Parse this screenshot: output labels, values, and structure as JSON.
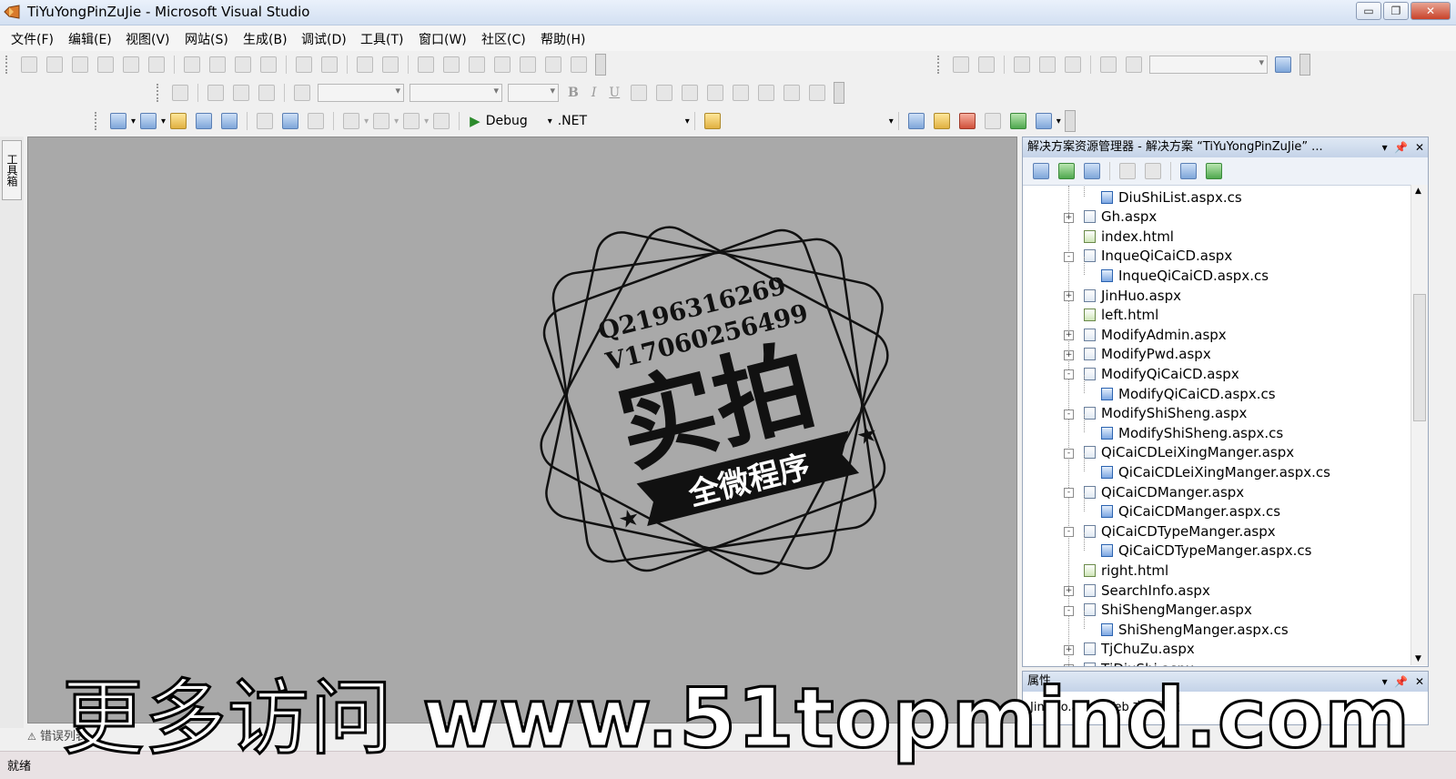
{
  "window": {
    "title": "TiYuYongPinZuJie - Microsoft Visual Studio",
    "minimize": "▭",
    "restore": "❐",
    "close": "✕"
  },
  "menu": [
    "文件(F)",
    "编辑(E)",
    "视图(V)",
    "网站(S)",
    "生成(B)",
    "调试(D)",
    "工具(T)",
    "窗口(W)",
    "社区(C)",
    "帮助(H)"
  ],
  "toolbar": {
    "config": "Debug",
    "platform": ".NET",
    "bold": "B",
    "italic": "I",
    "underline": "U"
  },
  "toolbox": {
    "label": "工具箱"
  },
  "editor": {
    "stamp": {
      "line1": "Q2196316269",
      "line2": "V17060256499",
      "big": "实拍",
      "banner": "全微程序"
    }
  },
  "solution_explorer": {
    "title": "解决方案资源管理器 - 解决方案 “TiYuYongPinZuJie” ...",
    "items": [
      {
        "label": "DiuShiList.aspx.cs",
        "type": "cs",
        "level": 2
      },
      {
        "label": "Gh.aspx",
        "type": "aspx",
        "level": 1,
        "expander": "+"
      },
      {
        "label": "index.html",
        "type": "html",
        "level": 1
      },
      {
        "label": "InqueQiCaiCD.aspx",
        "type": "aspx",
        "level": 1,
        "expander": "-"
      },
      {
        "label": "InqueQiCaiCD.aspx.cs",
        "type": "cs",
        "level": 2
      },
      {
        "label": "JinHuo.aspx",
        "type": "aspx",
        "level": 1,
        "expander": "+"
      },
      {
        "label": "left.html",
        "type": "html",
        "level": 1
      },
      {
        "label": "ModifyAdmin.aspx",
        "type": "aspx",
        "level": 1,
        "expander": "+"
      },
      {
        "label": "ModifyPwd.aspx",
        "type": "aspx",
        "level": 1,
        "expander": "+"
      },
      {
        "label": "ModifyQiCaiCD.aspx",
        "type": "aspx",
        "level": 1,
        "expander": "-"
      },
      {
        "label": "ModifyQiCaiCD.aspx.cs",
        "type": "cs",
        "level": 2
      },
      {
        "label": "ModifyShiSheng.aspx",
        "type": "aspx",
        "level": 1,
        "expander": "-"
      },
      {
        "label": "ModifyShiSheng.aspx.cs",
        "type": "cs",
        "level": 2
      },
      {
        "label": "QiCaiCDLeiXingManger.aspx",
        "type": "aspx",
        "level": 1,
        "expander": "-"
      },
      {
        "label": "QiCaiCDLeiXingManger.aspx.cs",
        "type": "cs",
        "level": 2
      },
      {
        "label": "QiCaiCDManger.aspx",
        "type": "aspx",
        "level": 1,
        "expander": "-"
      },
      {
        "label": "QiCaiCDManger.aspx.cs",
        "type": "cs",
        "level": 2
      },
      {
        "label": "QiCaiCDTypeManger.aspx",
        "type": "aspx",
        "level": 1,
        "expander": "-"
      },
      {
        "label": "QiCaiCDTypeManger.aspx.cs",
        "type": "cs",
        "level": 2
      },
      {
        "label": "right.html",
        "type": "html",
        "level": 1
      },
      {
        "label": "SearchInfo.aspx",
        "type": "aspx",
        "level": 1,
        "expander": "+"
      },
      {
        "label": "ShiShengManger.aspx",
        "type": "aspx",
        "level": 1,
        "expander": "-"
      },
      {
        "label": "ShiShengManger.aspx.cs",
        "type": "cs",
        "level": 2
      },
      {
        "label": "TjChuZu.aspx",
        "type": "aspx",
        "level": 1,
        "expander": "+"
      },
      {
        "label": "TjDiuShi.aspx",
        "type": "aspx",
        "level": 1,
        "expander": "+"
      }
    ]
  },
  "properties": {
    "title": "属性",
    "value": "JinHuo.aspx  Web 文件属性"
  },
  "bottom": {
    "error_tab": "错误列表",
    "status": "就绪"
  },
  "watermark": {
    "prefix": "更多访问",
    "url": "www.51topmind.com"
  }
}
